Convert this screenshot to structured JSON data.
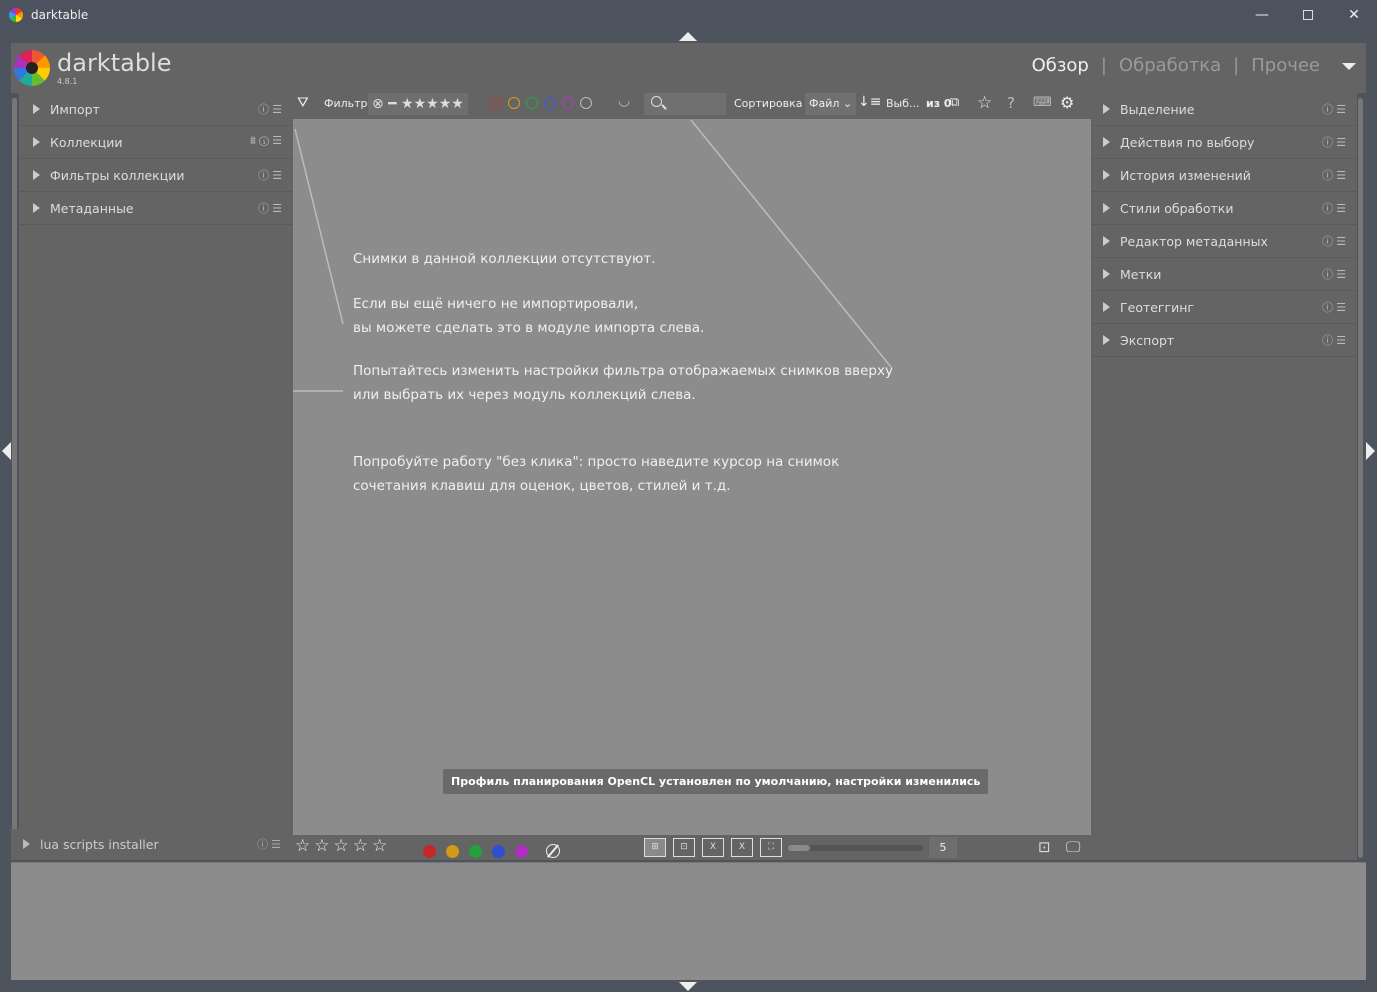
{
  "window": {
    "title": "darktable",
    "minimize": "—",
    "close": "✕"
  },
  "header": {
    "logo": "darktable",
    "version": "4.8.1",
    "views": [
      "Обзор",
      "Обработка",
      "Прочее"
    ],
    "separator": "|"
  },
  "left_modules": [
    {
      "label": "Импорт",
      "icons": "ⓘ☰"
    },
    {
      "label": "Коллекции",
      "icons": "⩩ⓘ☰"
    },
    {
      "label": "Фильтры коллекции",
      "icons": "ⓘ☰"
    },
    {
      "label": "Метаданные",
      "icons": "ⓘ☰"
    }
  ],
  "right_modules": [
    {
      "label": "Выделение",
      "icons": "ⓘ☰"
    },
    {
      "label": "Действия по выбору",
      "icons": "ⓘ☰"
    },
    {
      "label": "История изменений",
      "icons": "ⓘ☰"
    },
    {
      "label": "Стили обработки",
      "icons": "ⓘ☰"
    },
    {
      "label": "Редактор метаданных",
      "icons": "ⓘ☰"
    },
    {
      "label": "Метки",
      "icons": "ⓘ☰"
    },
    {
      "label": "Геотеггинг",
      "icons": "ⓘ☰"
    },
    {
      "label": "Экспорт",
      "icons": "ⓘ☰"
    }
  ],
  "filterbar": {
    "filter_label": "Фильтр",
    "rating": "⊗ ━ ★★★★★",
    "color_labels": [
      "#c0392b",
      "#d4a017",
      "#27a844",
      "#3a5bd9",
      "#b13ac9",
      "#bbbbbb"
    ],
    "sort_label": "Сортировка",
    "sort_value": "Файл",
    "selection": "Выб...",
    "of_count": "из 0"
  },
  "center": {
    "messages": [
      [
        "Снимки в данной коллекции отсутствуют."
      ],
      [
        "Если вы ещё ничего не импортировали,",
        "вы можете сделать это в модуле импорта слева."
      ],
      [
        "Попытайтесь изменить настройки фильтра отображаемых снимков вверху",
        "или выбрать их через модуль коллекций слева."
      ],
      [
        "Попробуйте работу \"без клика\": просто наведите курсор на снимок",
        "сочетания клавиш для оценок, цветов, стилей и т.д."
      ]
    ],
    "toast": "Профиль планирования OpenCL установлен по умолчанию, настройки изменились"
  },
  "bottombar": {
    "stars": "☆☆☆☆☆",
    "color_dots": [
      "#c62828",
      "#d39a1a",
      "#22a33a",
      "#2f4fd1",
      "#b12fc0"
    ],
    "zoom_value": "5"
  },
  "lua": {
    "label": "lua scripts installer",
    "icons": "ⓘ☰"
  }
}
